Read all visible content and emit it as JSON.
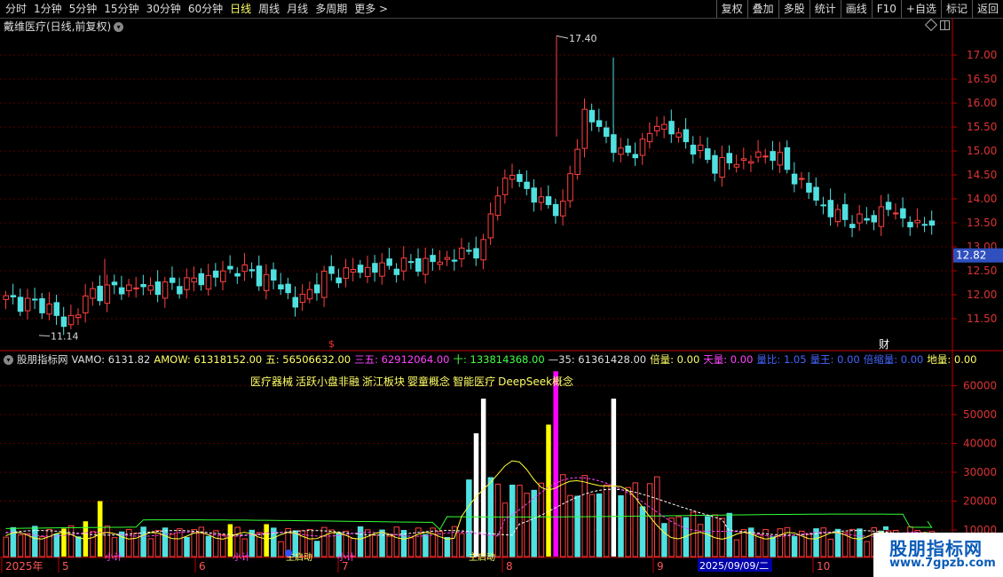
{
  "toolbar": {
    "periods": [
      "分时",
      "1分钟",
      "5分钟",
      "15分钟",
      "30分钟",
      "60分钟",
      "日线",
      "周线",
      "月线",
      "多周期",
      "更多 >"
    ],
    "active_index": 6,
    "buttons": [
      "复权",
      "叠加",
      "多股",
      "统计",
      "画线",
      "F10",
      "+自选",
      "标记",
      "返回"
    ]
  },
  "title": "戴维医疗(日线,前复权)",
  "price_axis": {
    "ticks": [
      "17.00",
      "16.50",
      "16.00",
      "15.50",
      "15.00",
      "14.50",
      "14.00",
      "13.50",
      "13.00",
      "12.50",
      "12.00",
      "11.50"
    ],
    "current": "12.82",
    "current_color": "#3050c0"
  },
  "annotations": {
    "high": "17.40",
    "low": "11.14",
    "dollar_mark": "$",
    "cai_mark": "财"
  },
  "indicator": {
    "name": "股朋指标网",
    "items": [
      {
        "label": "VAMO: 6131.82",
        "color": "#dddddd"
      },
      {
        "label": "AMOW: 61318152.00",
        "color": "#ffff66"
      },
      {
        "label": "五: 56506632.00",
        "color": "#ffff66"
      },
      {
        "label": "三五: 62912064.00",
        "color": "#ff44ff"
      },
      {
        "label": "十: 133814368.00",
        "color": "#44ff44"
      },
      {
        "label": "—35: 61361428.00",
        "color": "#dddddd"
      },
      {
        "label": "倍量: 0.00",
        "color": "#ffff66"
      },
      {
        "label": "天量: 0.00",
        "color": "#ff44ff"
      },
      {
        "label": "量比: 1.05",
        "color": "#4466ff"
      },
      {
        "label": "量王: 0.00",
        "color": "#4466ff"
      },
      {
        "label": "倍缩量: 0.00",
        "color": "#4466ff"
      },
      {
        "label": "地量: 0.00",
        "color": "#ffff66"
      }
    ]
  },
  "concepts": [
    "医疗器械",
    "活跃小盘非融",
    "浙江板块",
    "婴童概念",
    "智能医疗",
    "DeepSeek概念"
  ],
  "volume_axis": [
    "60000",
    "50000",
    "40000",
    "30000",
    "20000",
    "10000"
  ],
  "date_axis": {
    "labels": [
      "2025年",
      "5",
      "6",
      "7",
      "8",
      "9",
      "10"
    ],
    "cursor_date": "2025/09/09/二"
  },
  "markers": [
    "小计",
    "小计",
    "主启动",
    "小计",
    "主启动"
  ],
  "watermark": {
    "line1": "股朋指标网",
    "line2": "www.7gpzb.com"
  },
  "colors": {
    "up": "#ff4040",
    "down": "#50e0e0",
    "grid": "#5a0000",
    "axis": "#c00000"
  }
}
